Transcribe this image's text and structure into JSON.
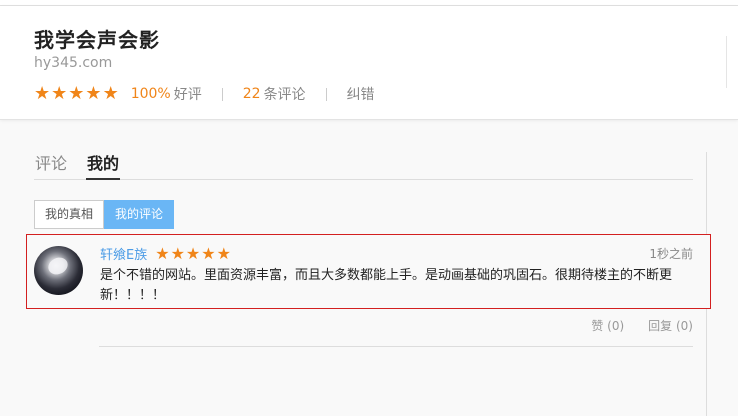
{
  "site": {
    "title": "我学会声会影",
    "url": "hy345.com",
    "rating_stars": 5,
    "positive_rate": "100%",
    "positive_label": "好评",
    "review_count": "22",
    "review_count_label": "条评论",
    "report_label": "纠错"
  },
  "tabs": [
    {
      "label": "评论",
      "active": false
    },
    {
      "label": "我的",
      "active": true
    }
  ],
  "subtabs": [
    {
      "label": "我的真相",
      "active": false
    },
    {
      "label": "我的评论",
      "active": true
    }
  ],
  "comment": {
    "username": "轩飨E族",
    "stars": 5,
    "time": "1秒之前",
    "text": "是个不错的网站。里面资源丰富，而且大多数都能上手。是动画基础的巩固石。很期待楼主的不断更新！！！！",
    "like_label": "赞 (0)",
    "reply_label": "回复 (0)"
  },
  "colors": {
    "accent": "#f08519",
    "link": "#4c9ce6",
    "active_tab_bg": "#6ab6f5",
    "highlight_border": "#d32020"
  },
  "icons": {
    "star": "star-icon"
  }
}
